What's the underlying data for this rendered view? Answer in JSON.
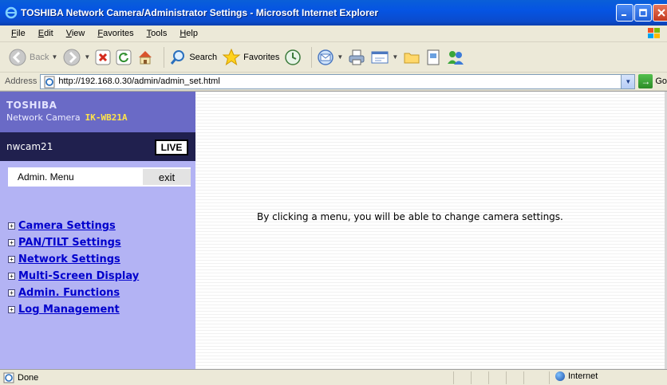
{
  "window": {
    "title": "TOSHIBA Network Camera/Administrator Settings - Microsoft Internet Explorer"
  },
  "menubar": {
    "items": [
      "File",
      "Edit",
      "View",
      "Favorites",
      "Tools",
      "Help"
    ]
  },
  "toolbar": {
    "back_label": "Back",
    "search_label": "Search",
    "favorites_label": "Favorites"
  },
  "addressbar": {
    "label": "Address",
    "url": "http://192.168.0.30/admin/admin_set.html",
    "go_label": "Go"
  },
  "sidebar": {
    "brand": "TOSHIBA",
    "product": "Network Camera",
    "model": "IK-WB21A",
    "camera_name": "nwcam21",
    "live_label": "LIVE",
    "admin_menu_label": "Admin. Menu",
    "exit_label": "exit",
    "nav_items": [
      {
        "label": "Camera Settings"
      },
      {
        "label": "PAN/TILT Settings"
      },
      {
        "label": "Network Settings"
      },
      {
        "label": "Multi-Screen Display"
      },
      {
        "label": "Admin. Functions"
      },
      {
        "label": "Log Management"
      }
    ]
  },
  "main": {
    "message": "By clicking a menu, you will be able to change camera settings."
  },
  "statusbar": {
    "status": "Done",
    "zone": "Internet"
  },
  "colors": {
    "sidebar_bg": "#b3b3f4",
    "brand_bg": "#6a6ac6",
    "camrow_bg": "#20204e",
    "model_color": "#ffe44a",
    "link_color": "#0000cc"
  }
}
